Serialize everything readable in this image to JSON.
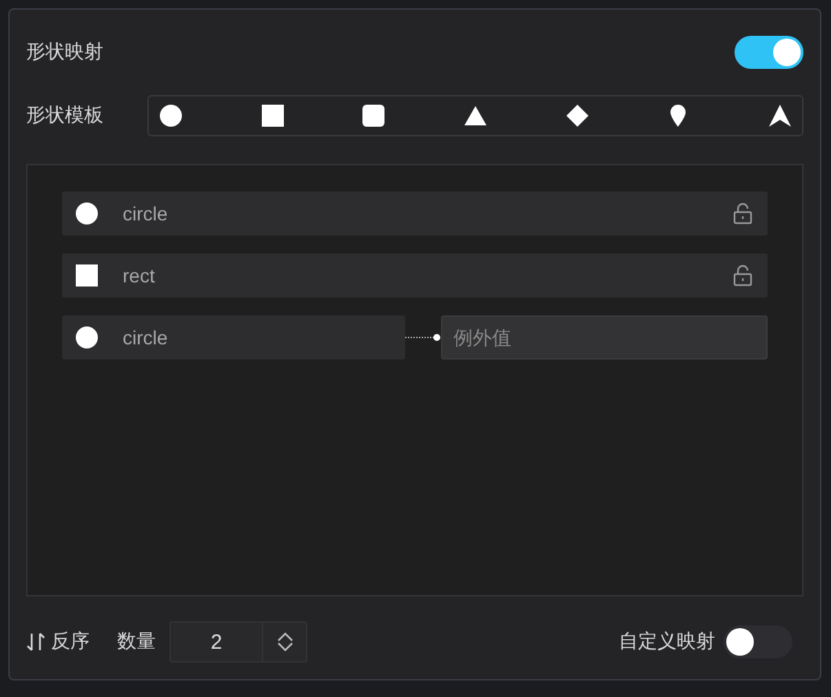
{
  "shape_mapping": {
    "label": "形状映射",
    "on": true
  },
  "shape_template": {
    "label": "形状模板",
    "shapes": [
      {
        "kind": "circle"
      },
      {
        "kind": "square"
      },
      {
        "kind": "rounded-square"
      },
      {
        "kind": "triangle"
      },
      {
        "kind": "diamond"
      },
      {
        "kind": "pin"
      },
      {
        "kind": "arrow"
      }
    ]
  },
  "mappings": [
    {
      "kind": "value",
      "shape": {
        "kind": "circle"
      },
      "label": "circle",
      "locked": false
    },
    {
      "kind": "value",
      "shape": {
        "kind": "square"
      },
      "label": "rect",
      "locked": false
    },
    {
      "kind": "exception",
      "shape": {
        "kind": "circle"
      },
      "label": "circle",
      "placeholder": "例外值"
    }
  ],
  "footer": {
    "reverse_label": "反序",
    "count_label": "数量",
    "count_value": "2",
    "custom_mapping": {
      "label": "自定义映射",
      "on": false
    }
  }
}
